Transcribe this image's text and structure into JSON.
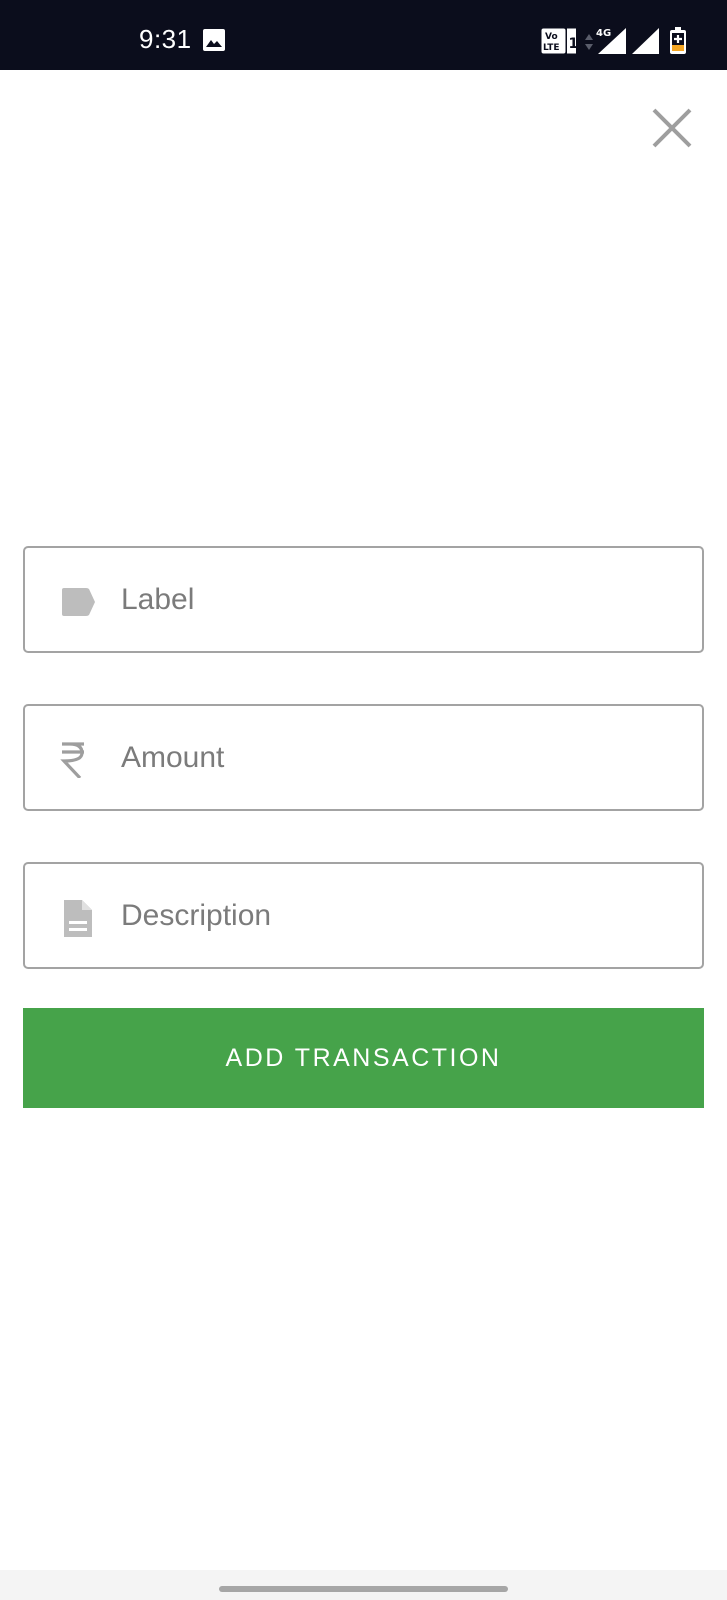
{
  "status_bar": {
    "time": "9:31",
    "network_type": "4G",
    "icons": [
      "gallery-icon",
      "volte-icon",
      "data-arrows-icon",
      "signal-4g-icon",
      "signal-icon",
      "battery-charging-icon"
    ]
  },
  "header": {
    "close_icon": "close-icon"
  },
  "form": {
    "label_field": {
      "placeholder": "Label",
      "icon": "tag-icon"
    },
    "amount_field": {
      "placeholder": "Amount",
      "icon": "rupee-icon"
    },
    "description_field": {
      "placeholder": "Description",
      "icon": "document-icon"
    },
    "submit_label": "ADD TRANSACTION"
  },
  "colors": {
    "status_bar_bg": "#0b0d1c",
    "accent_green": "#46a34a",
    "field_border": "#a3a3a3",
    "icon_gray": "#9e9e9e",
    "placeholder_gray": "#7b7b7b"
  }
}
